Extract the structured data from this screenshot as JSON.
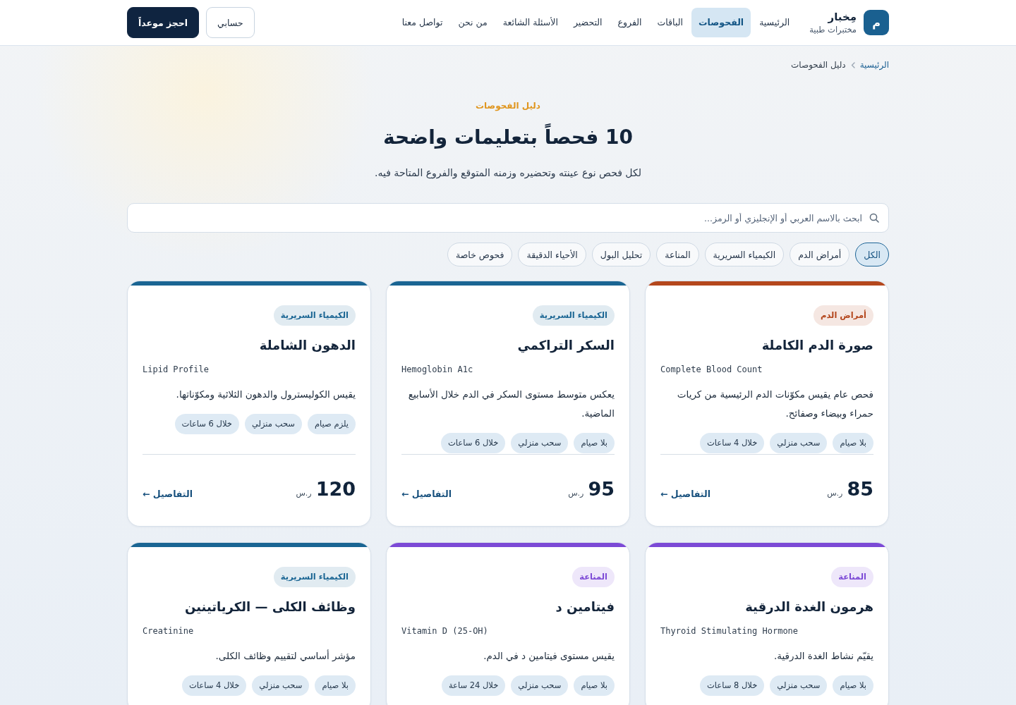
{
  "header": {
    "logo": {
      "mark": "م",
      "name": "مِخبار",
      "tagline": "مختبرات طبية"
    },
    "nav": [
      {
        "label": "الرئيسية",
        "selected": false
      },
      {
        "label": "الفحوصات",
        "selected": true
      },
      {
        "label": "الباقات",
        "selected": false
      },
      {
        "label": "الفروع",
        "selected": false
      },
      {
        "label": "التحضير",
        "selected": false
      },
      {
        "label": "الأسئلة الشائعة",
        "selected": false
      },
      {
        "label": "من نحن",
        "selected": false
      },
      {
        "label": "تواصل معنا",
        "selected": false
      }
    ],
    "actions": [
      {
        "label": "حسابي",
        "kind": "outline"
      },
      {
        "label": "احجز موعداً",
        "kind": "primary"
      }
    ]
  },
  "breadcrumb": [
    {
      "label": "الرئيسية",
      "kind": "link"
    },
    {
      "label": "دليل الفحوصات",
      "kind": "current"
    }
  ],
  "hero": {
    "eyebrow": "دليل الفحوصات",
    "title": "10 فحصاً بتعليمات واضحة",
    "subtitle": "لكل فحص نوع عينته وتحضيره وزمنه المتوقع والفروع المتاحة فيه."
  },
  "search": {
    "placeholder": "ابحث بالاسم العربي أو الإنجليزي أو الرمز..."
  },
  "filters": [
    {
      "label": "الكل",
      "selected": true
    },
    {
      "label": "أمراض الدم",
      "selected": false
    },
    {
      "label": "الكيمياء السريرية",
      "selected": false
    },
    {
      "label": "المناعة",
      "selected": false
    },
    {
      "label": "تحليل البول",
      "selected": false
    },
    {
      "label": "الأحياء الدقيقة",
      "selected": false
    },
    {
      "label": "فحوص خاصة",
      "selected": false
    }
  ],
  "tests": [
    {
      "category": "أمراض الدم",
      "color": "#b4471d",
      "name": "صورة الدم الكاملة",
      "english_name": "Complete Blood Count",
      "description": "فحص عام يقيس مكوّنات الدم الرئيسية من كريات حمراء وبيضاء وصفائح.",
      "tags": [
        "بلا صيام",
        "سحب منزلي",
        "خلال 4 ساعات"
      ],
      "price": "85",
      "currency": "ر.س",
      "details_link": "التفاصيل ←"
    },
    {
      "category": "الكيمياء السريرية",
      "color": "#1a6593",
      "name": "السكر التراكمي",
      "english_name": "Hemoglobin A1c",
      "description": "يعكس متوسط مستوى السكر في الدم خلال الأسابيع الماضية.",
      "tags": [
        "بلا صيام",
        "سحب منزلي",
        "خلال 6 ساعات"
      ],
      "price": "95",
      "currency": "ر.س",
      "details_link": "التفاصيل ←"
    },
    {
      "category": "الكيمياء السريرية",
      "color": "#1a6593",
      "name": "الدهون الشاملة",
      "english_name": "Lipid Profile",
      "description": "يقيس الكوليسترول والدهون الثلاثية ومكوّناتها.",
      "tags": [
        "يلزم صيام",
        "سحب منزلي",
        "خلال 6 ساعات"
      ],
      "price": "120",
      "currency": "ر.س",
      "details_link": "التفاصيل ←"
    },
    {
      "category": "المناعة",
      "color": "#7c4ad6",
      "name": "هرمون الغدة الدرقية",
      "english_name": "Thyroid Stimulating Hormone",
      "description": "يقيّم نشاط الغدة الدرقية.",
      "tags": [
        "بلا صيام",
        "سحب منزلي",
        "خلال 8 ساعات"
      ]
    },
    {
      "category": "المناعة",
      "color": "#7c4ad6",
      "name": "فيتامين د",
      "english_name": "Vitamin D (25-OH)",
      "description": "يقيس مستوى فيتامين د في الدم.",
      "tags": [
        "بلا صيام",
        "سحب منزلي",
        "خلال 24 ساعة"
      ]
    },
    {
      "category": "الكيمياء السريرية",
      "color": "#1a6593",
      "name": "وظائف الكلى — الكرياتينين",
      "english_name": "Creatinine",
      "description": "مؤشر أساسي لتقييم وظائف الكلى.",
      "tags": [
        "بلا صيام",
        "سحب منزلي",
        "خلال 4 ساعات"
      ]
    }
  ]
}
